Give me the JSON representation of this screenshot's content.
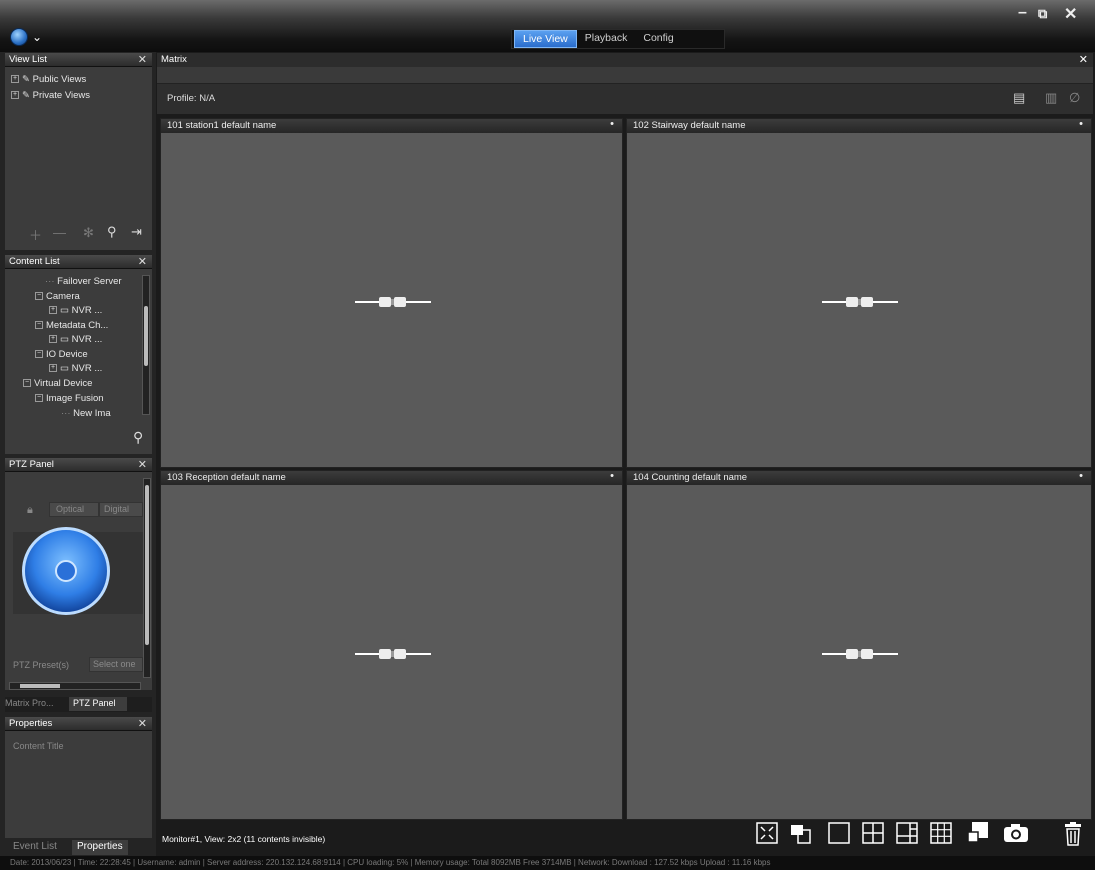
{
  "titlebar": {
    "logo_icon": "globe-icon",
    "menu_caret": "⌄",
    "minimize": "–",
    "restore": "⧉",
    "close": "✕"
  },
  "tabs": [
    {
      "label": "Live View",
      "active": true
    },
    {
      "label": "Playback",
      "active": false
    },
    {
      "label": "Config",
      "active": false
    }
  ],
  "view_list": {
    "title": "View List",
    "items": [
      "Public Views",
      "Private Views"
    ]
  },
  "content_list": {
    "title": "Content List",
    "items": [
      {
        "label": "Failover Server",
        "level": 2
      },
      {
        "label": "Camera",
        "level": 1
      },
      {
        "label": "NVR ...",
        "level": 2
      },
      {
        "label": "Metadata Ch...",
        "level": 1
      },
      {
        "label": "NVR ...",
        "level": 2
      },
      {
        "label": "IO Device",
        "level": 1
      },
      {
        "label": "NVR ...",
        "level": 2
      },
      {
        "label": "Virtual Device",
        "level": 0
      },
      {
        "label": "Image Fusion",
        "level": 1
      },
      {
        "label": "New Ima",
        "level": 2
      }
    ]
  },
  "ptz_panel": {
    "title": "PTZ Panel",
    "optical": "Optical",
    "digital": "Digital",
    "presets_label": "PTZ Preset(s)",
    "preset_value": "Select one"
  },
  "panel_tabs": {
    "left": "Matrix Pro...",
    "active": "PTZ Panel"
  },
  "properties": {
    "title": "Properties",
    "content_title": "Content Title"
  },
  "bottom_tabs": {
    "event_list": "Event List",
    "properties": "Properties"
  },
  "matrix": {
    "title": "Matrix",
    "profile": "Profile: N/A"
  },
  "cells": [
    {
      "label": "101  station1  default name"
    },
    {
      "label": "102  Stairway  default name"
    },
    {
      "label": "103  Reception  default name"
    },
    {
      "label": "104  Counting  default name"
    }
  ],
  "status": {
    "monitor": "Monitor#1, View: 2x2 (11 contents invisible)",
    "footer": "Date: 2013/06/23  |  Time: 22:28:45  |  Username: admin  |  Server address: 220.132.124.68:9114  |  CPU loading: 5%  |  Memory usage: Total 8092MB  Free 3714MB  |  Network: Download : 127.52 kbps  Upload : 11.16 kbps"
  }
}
